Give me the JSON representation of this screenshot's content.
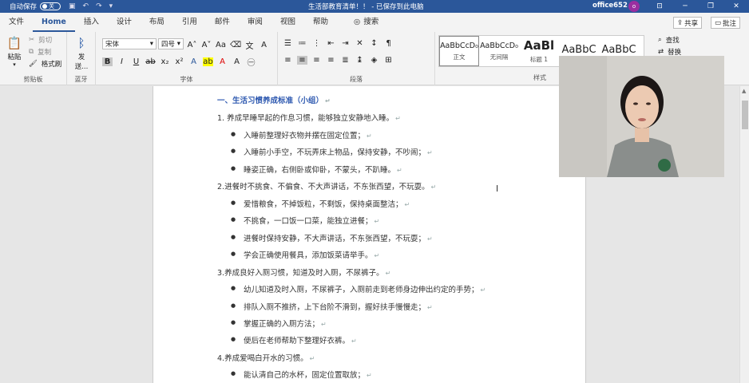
{
  "titlebar": {
    "autosave_label": "自动保存",
    "autosave_state": "关",
    "title": "生活部教育清单！！ - 已保存到此电脑",
    "user": "office652",
    "avatar_initial": "o"
  },
  "tabs": [
    "文件",
    "Home",
    "插入",
    "设计",
    "布局",
    "引用",
    "邮件",
    "审阅",
    "视图",
    "帮助"
  ],
  "search_label": "搜索",
  "share_label": "共享",
  "comment_label": "批注",
  "ribbon": {
    "clipboard": {
      "paste": "粘贴",
      "cut": "剪切",
      "copy": "复制",
      "format_painter": "格式刷",
      "label": "剪贴板"
    },
    "bluetooth": {
      "send": "发",
      "send2": "送...",
      "label": "蓝牙"
    },
    "font": {
      "name": "宋体",
      "size": "四号",
      "label": "字体"
    },
    "paragraph": {
      "label": "段落"
    },
    "styles": {
      "items": [
        {
          "sample": "AaBbCcD₀",
          "name": "正文"
        },
        {
          "sample": "AaBbCcD₀",
          "name": "无间隔"
        },
        {
          "sample": "AaBl",
          "name": "标题 1"
        },
        {
          "sample": "AaBbC",
          "name": ""
        },
        {
          "sample": "AaBbC",
          "name": ""
        }
      ],
      "label": "样式"
    },
    "editing": {
      "find": "查找",
      "replace": "替换"
    }
  },
  "document": {
    "lines": [
      {
        "type": "heading",
        "text": "一、生活习惯养成标准（小组）"
      },
      {
        "type": "numbered",
        "text": "1. 养成早睡早起的作息习惯，能够独立安静地入睡。"
      },
      {
        "type": "bullet",
        "text": "入睡前整理好衣物并摆在固定位置；"
      },
      {
        "type": "bullet",
        "text": "入睡前小手空，不玩弄床上物品，保持安静，不吵闹；"
      },
      {
        "type": "bullet",
        "text": "睡姿正确，右侧卧或仰卧，不蒙头，不趴睡。"
      },
      {
        "type": "numbered",
        "text": "2.进餐时不挑食、不偏食、不大声讲话，不东张西望，不玩耍。"
      },
      {
        "type": "bullet",
        "text": "爱惜粮食，不掉饭粒，不剩饭，保持桌面整洁；"
      },
      {
        "type": "bullet",
        "text": "不挑食，一口饭一口菜，能独立进餐；"
      },
      {
        "type": "bullet",
        "text": "进餐时保持安静，不大声讲话，不东张西望，不玩耍；"
      },
      {
        "type": "bullet",
        "text": "学会正确使用餐具，添加饭菜请举手。"
      },
      {
        "type": "numbered",
        "text": "3.养成良好入厕习惯，知道及时入厕，不尿裤子。"
      },
      {
        "type": "bullet",
        "text": "幼儿知道及时入厕，不尿裤子，入厕前走到老师身边伸出约定的手势；"
      },
      {
        "type": "bullet",
        "text": "排队入厕不推挤，上下台阶不滑到，握好扶手慢慢走；"
      },
      {
        "type": "bullet",
        "text": "掌握正确的入厕方法；"
      },
      {
        "type": "bullet",
        "text": "便后在老师帮助下整理好衣裤。"
      },
      {
        "type": "numbered",
        "text": "4.养成爱喝白开水的习惯。"
      },
      {
        "type": "bullet",
        "text": "能认清自己的水杯，固定位置取放；"
      }
    ]
  },
  "colors": {
    "accent": "#2b579a",
    "heading": "#2e59b0"
  }
}
